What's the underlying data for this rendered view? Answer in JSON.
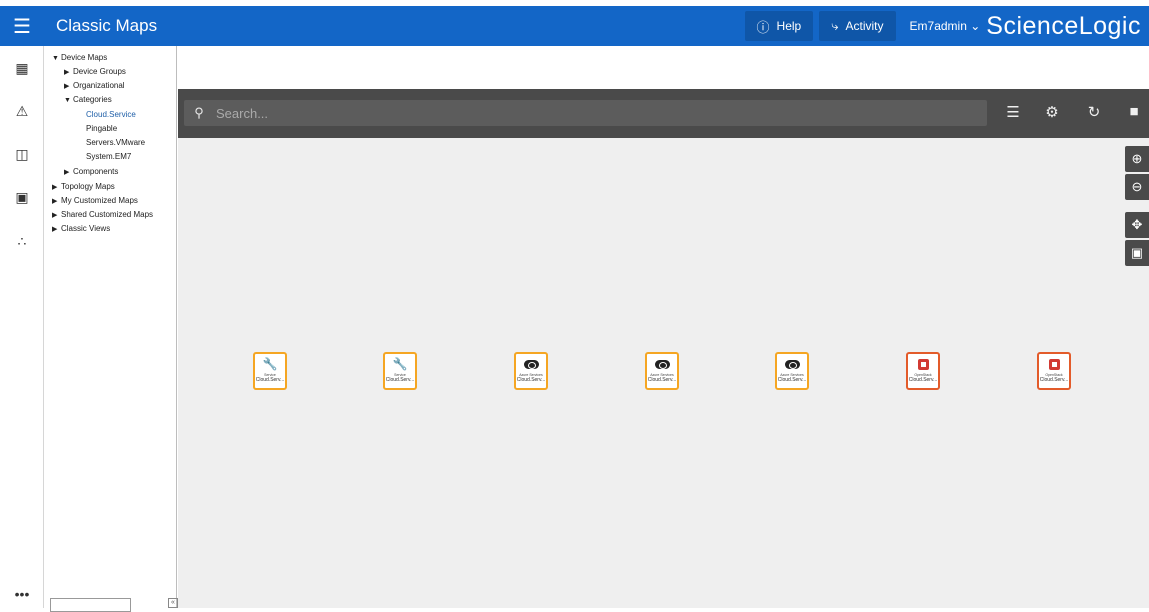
{
  "app": {
    "title": "Classic Maps"
  },
  "header": {
    "help_label": "Help",
    "activity_label": "Activity",
    "user_label": "Em7admin",
    "brand": "ScienceLogic"
  },
  "nav_icons": [
    "dashboard-icon",
    "alert-icon",
    "devices-icon",
    "toolbox-icon",
    "topology-icon",
    "more-icon"
  ],
  "tree": {
    "device_maps": "Device Maps",
    "device_groups": "Device Groups",
    "organizational": "Organizational",
    "categories": "Categories",
    "category_items": [
      "Cloud.Service",
      "Pingable",
      "Servers.VMware",
      "System.EM7"
    ],
    "components": "Components",
    "topology_maps": "Topology Maps",
    "my_customized_maps": "My Customized Maps",
    "shared_customized_maps": "Shared Customized Maps",
    "classic_views": "Classic Views"
  },
  "toolbar": {
    "search_placeholder": "Search..."
  },
  "nodes": [
    {
      "sub": "Service",
      "name": "Cloud.Serv...",
      "icon": "wrench-icon"
    },
    {
      "sub": "Service",
      "name": "Cloud.Serv...",
      "icon": "wrench-icon"
    },
    {
      "sub": "Azure Services",
      "name": "Cloud.Serv...",
      "icon": "cloud-icon"
    },
    {
      "sub": "Azure Services",
      "name": "Cloud.Serv...",
      "icon": "cloud-icon"
    },
    {
      "sub": "Azure Services",
      "name": "Cloud.Serv...",
      "icon": "cloud-icon"
    },
    {
      "sub": "OpenStack",
      "name": "Cloud.Serv...",
      "icon": "openstack-icon"
    },
    {
      "sub": "OpenStack",
      "name": "Cloud.Serv...",
      "icon": "openstack-icon"
    }
  ],
  "colors": {
    "brand_blue": "#1366c7",
    "toolbar_gray": "#4a4a4a",
    "node_border": "#f5a623",
    "node_border_red": "#e35b2a"
  }
}
